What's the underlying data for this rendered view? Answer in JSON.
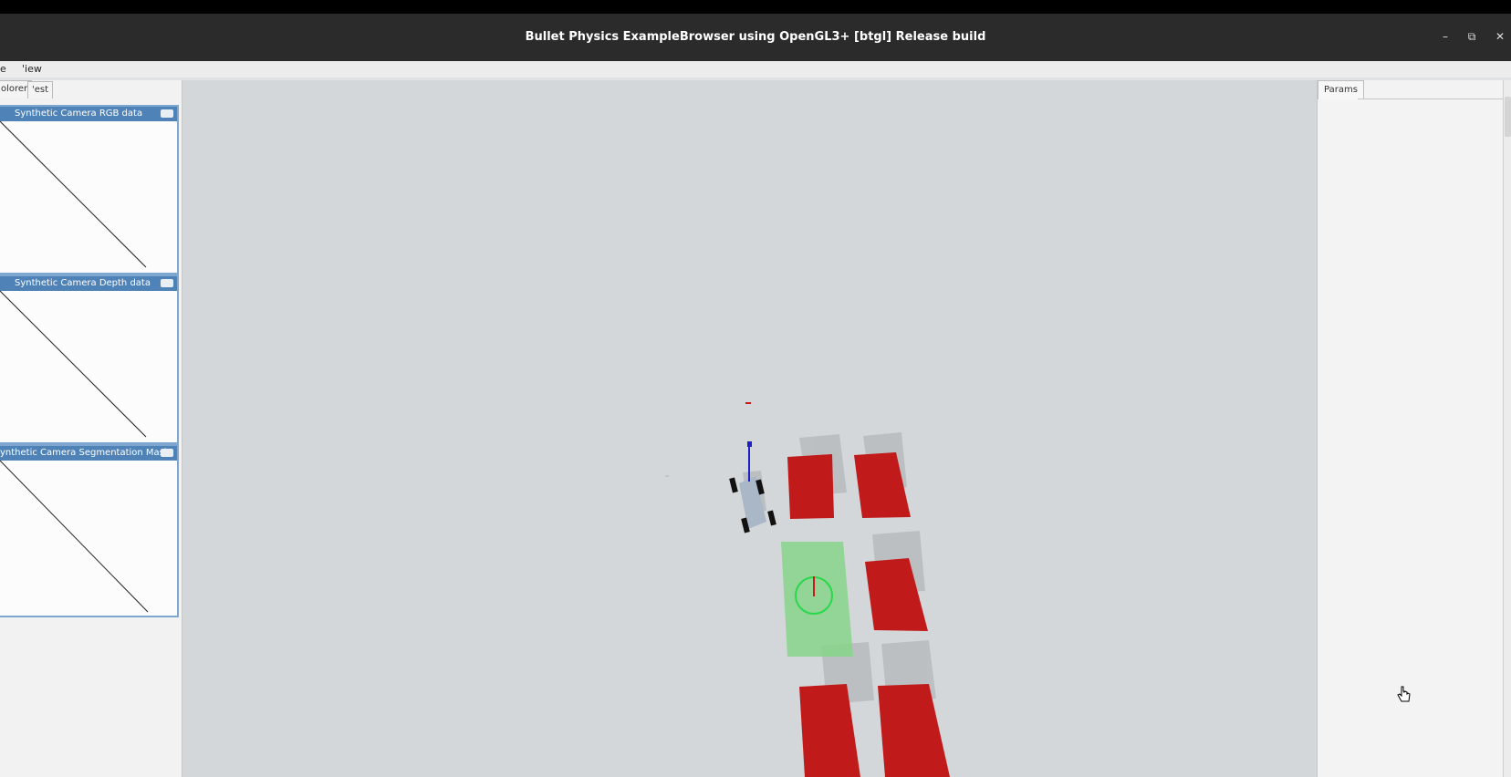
{
  "window": {
    "title": "Bullet Physics ExampleBrowser using OpenGL3+ [btgl] Release build",
    "buttons": [
      "–",
      "⧉",
      "✕"
    ]
  },
  "menu": {
    "items": [
      "e",
      "'iew"
    ]
  },
  "left_panel": {
    "tabs": [
      "olorer",
      "'est"
    ],
    "subwindows": [
      {
        "title": "Synthetic Camera RGB data"
      },
      {
        "title": "Synthetic Camera Depth data"
      },
      {
        "title": "ynthetic Camera Segmentation Mask"
      }
    ]
  },
  "right_panel": {
    "tab": "Params"
  },
  "colors": {
    "viewport_bg": "#d4d7d9",
    "box_red": "#c11a1a",
    "target_green": "#86d58a",
    "panel_header": "#4f83b8"
  }
}
